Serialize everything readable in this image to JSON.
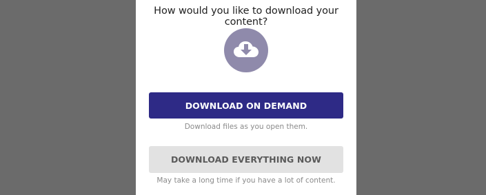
{
  "dialog": {
    "title": "How would you like to download your content?",
    "icon": "cloud-download-icon",
    "primary_button": {
      "label": "DOWNLOAD ON DEMAND",
      "hint": "Download files as you open them."
    },
    "secondary_button": {
      "label": "DOWNLOAD EVERYTHING NOW",
      "hint": "May take a long time if you have a lot of content."
    }
  },
  "colors": {
    "backdrop": "#6b6b6b",
    "primary": "#2e2a86",
    "icon_circle": "#8f8aab",
    "secondary_bg": "#e2e2e2"
  }
}
